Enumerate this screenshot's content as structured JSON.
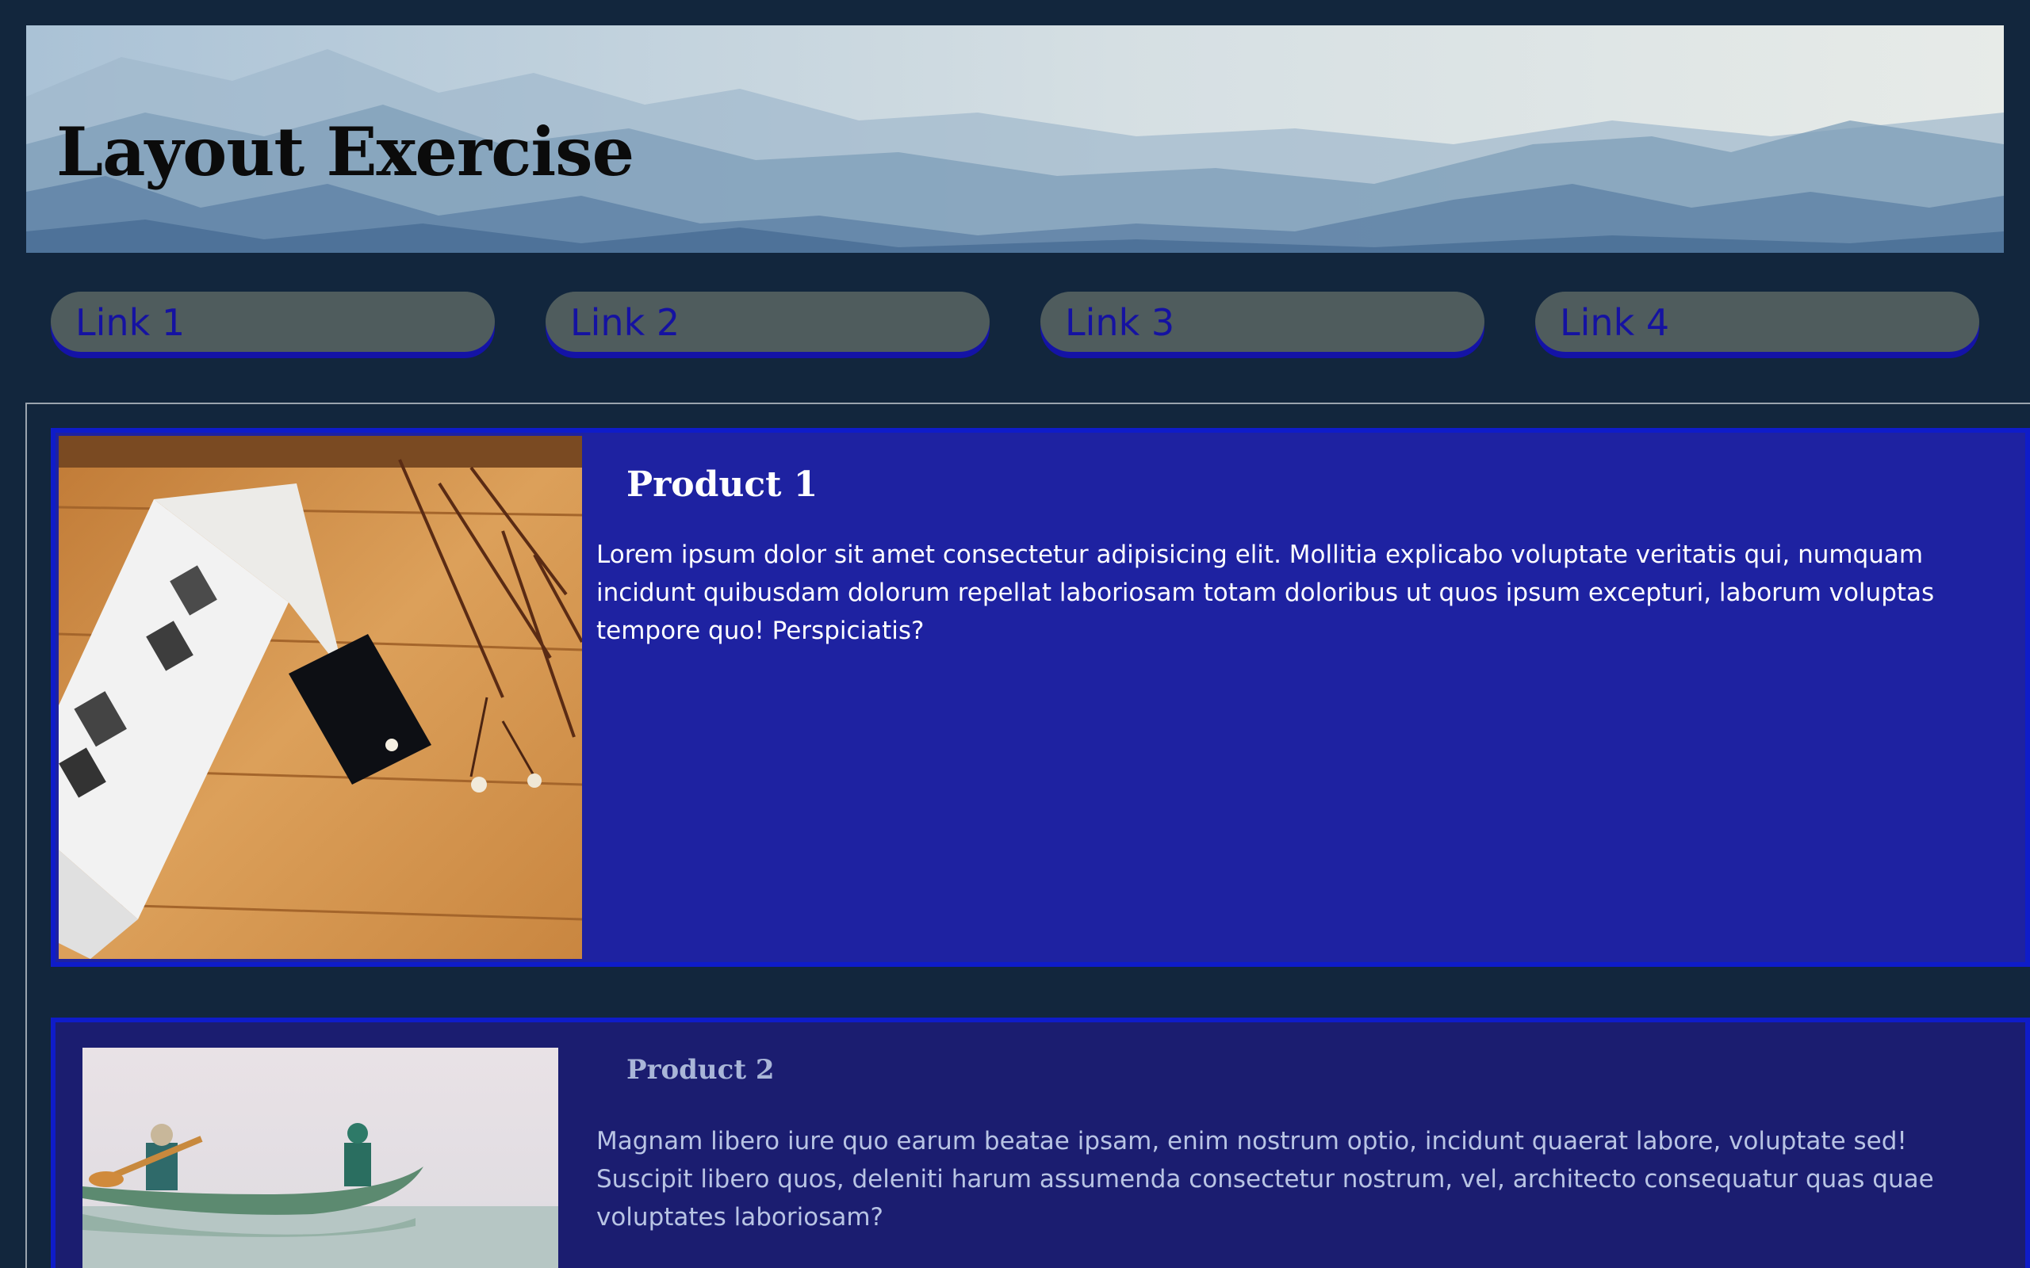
{
  "header": {
    "title": "Layout Exercise"
  },
  "nav": {
    "links": [
      {
        "label": "Link 1"
      },
      {
        "label": "Link 2"
      },
      {
        "label": "Link 3"
      },
      {
        "label": "Link 4"
      }
    ]
  },
  "products": [
    {
      "title": "Product 1",
      "description": "Lorem ipsum dolor sit amet consectetur adipisicing elit. Mollitia explicabo voluptate veritatis qui, numquam incidunt quibusdam dolorum repellat laboriosam totam doloribus ut quos ipsum excepturi, laborum voluptas tempore quo! Perspiciatis?"
    },
    {
      "title": "Product 2",
      "description": "Magnam libero iure quo earum beatae ipsam, enim nostrum optio, incidunt quaerat labore, voluptate sed! Suscipit libero quos, deleniti harum assumenda consectetur nostrum, vel, architecto consequatur quas quae voluptates laboriosam?"
    }
  ],
  "colors": {
    "page_background": "#12263d",
    "nav_pill": "#4f5c5d",
    "nav_text": "#1512a1",
    "product_1_background": "#1e22a1",
    "product_2_background": "#1b1d70",
    "product_border": "#0f1cc9"
  }
}
